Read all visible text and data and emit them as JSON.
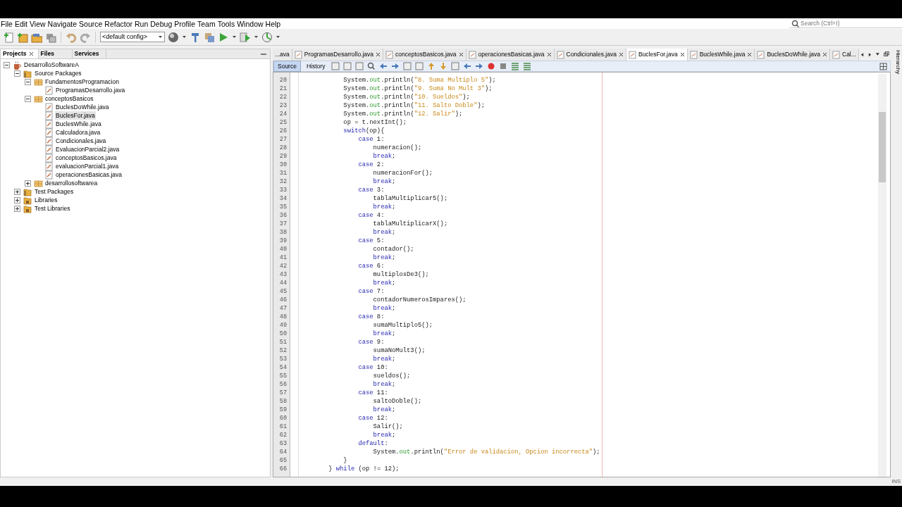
{
  "menu": [
    "File",
    "Edit",
    "View",
    "Navigate",
    "Source",
    "Refactor",
    "Run",
    "Debug",
    "Profile",
    "Team",
    "Tools",
    "Window",
    "Help"
  ],
  "search": {
    "placeholder": "Search (Ctrl+I)"
  },
  "toolbar": {
    "config": "<default config>"
  },
  "panel_tabs": [
    {
      "label": "Projects",
      "selected": true,
      "closable": true
    },
    {
      "label": "Files",
      "selected": false,
      "closable": false
    },
    {
      "label": "Services",
      "selected": false,
      "closable": false
    }
  ],
  "tree": [
    {
      "label": "DesarrolloSoftwareA",
      "kind": "project",
      "expanded": true,
      "selected": false,
      "children": [
        {
          "label": "Source Packages",
          "kind": "folder",
          "expanded": true,
          "selected": false,
          "children": [
            {
              "label": "FundamentosProgramacion",
              "kind": "package",
              "expanded": true,
              "selected": false,
              "children": [
                {
                  "label": "ProgramasDesarrollo.java",
                  "kind": "file",
                  "selected": false
                }
              ]
            },
            {
              "label": "conceptosBasicos",
              "kind": "package",
              "expanded": true,
              "selected": false,
              "children": [
                {
                  "label": "BuclesDoWhile.java",
                  "kind": "file",
                  "selected": false
                },
                {
                  "label": "BuclesFor.java",
                  "kind": "file",
                  "selected": true
                },
                {
                  "label": "BuclesWhile.java",
                  "kind": "file",
                  "selected": false
                },
                {
                  "label": "Calculadora.java",
                  "kind": "file",
                  "selected": false
                },
                {
                  "label": "Condicionales.java",
                  "kind": "file",
                  "selected": false
                },
                {
                  "label": "EvaluacionParcial2.java",
                  "kind": "file",
                  "selected": false
                },
                {
                  "label": "conceptosBasicos.java",
                  "kind": "file",
                  "selected": false
                },
                {
                  "label": "evaluacionParcial1.java",
                  "kind": "file",
                  "selected": false
                },
                {
                  "label": "operacionesBasicas.java",
                  "kind": "file",
                  "selected": false
                }
              ]
            },
            {
              "label": "desarrollosoftwarea",
              "kind": "package",
              "expanded": false,
              "selected": false
            }
          ]
        },
        {
          "label": "Test Packages",
          "kind": "folder",
          "expanded": false,
          "selected": false
        },
        {
          "label": "Libraries",
          "kind": "library",
          "expanded": false,
          "selected": false
        },
        {
          "label": "Test Libraries",
          "kind": "library",
          "expanded": false,
          "selected": false
        }
      ]
    }
  ],
  "editor_tabs": [
    {
      "label": "...ava",
      "selected": false,
      "closable": false
    },
    {
      "label": "ProgramasDesarrollo.java",
      "selected": false,
      "closable": true
    },
    {
      "label": "conceptosBasicos.java",
      "selected": false,
      "closable": true
    },
    {
      "label": "operacionesBasicas.java",
      "selected": false,
      "closable": true
    },
    {
      "label": "Condicionales.java",
      "selected": false,
      "closable": true
    },
    {
      "label": "BuclesFor.java",
      "selected": true,
      "closable": true
    },
    {
      "label": "BuclesWhile.java",
      "selected": false,
      "closable": true
    },
    {
      "label": "BuclesDoWhile.java",
      "selected": false,
      "closable": true
    },
    {
      "label": "Cal...",
      "selected": false,
      "closable": false
    }
  ],
  "view_tabs": [
    {
      "label": "Source",
      "selected": true
    },
    {
      "label": "History",
      "selected": false
    }
  ],
  "code": [
    {
      "number": "20",
      "parts": [
        {
          "plain": "            System."
        },
        {
          "field": "out"
        },
        {
          "plain": ".println("
        },
        {
          "string": "\"8. Suma Multiplo 5\""
        },
        {
          "plain": ");"
        }
      ]
    },
    {
      "number": "21",
      "parts": [
        {
          "plain": "            System."
        },
        {
          "field": "out"
        },
        {
          "plain": ".println("
        },
        {
          "string": "\"9. Suma No Mult 3\""
        },
        {
          "plain": ");"
        }
      ]
    },
    {
      "number": "22",
      "parts": [
        {
          "plain": "            System."
        },
        {
          "field": "out"
        },
        {
          "plain": ".println("
        },
        {
          "string": "\"10. Sueldos\""
        },
        {
          "plain": ");"
        }
      ]
    },
    {
      "number": "23",
      "parts": [
        {
          "plain": "            System."
        },
        {
          "field": "out"
        },
        {
          "plain": ".println("
        },
        {
          "string": "\"11. Salto Doble\""
        },
        {
          "plain": ");"
        }
      ]
    },
    {
      "number": "24",
      "parts": [
        {
          "plain": "            System."
        },
        {
          "field": "out"
        },
        {
          "plain": ".println("
        },
        {
          "string": "\"12. Salir\""
        },
        {
          "plain": ");"
        }
      ]
    },
    {
      "number": "25",
      "parts": [
        {
          "plain": "            op = t.nextInt();"
        }
      ]
    },
    {
      "number": "26",
      "parts": [
        {
          "keyword": "            switch"
        },
        {
          "plain": "(op){"
        }
      ]
    },
    {
      "number": "27",
      "parts": [
        {
          "keyword": "                case"
        },
        {
          "plain": " 1:"
        }
      ]
    },
    {
      "number": "28",
      "parts": [
        {
          "plain": "                    numeracion();"
        }
      ]
    },
    {
      "number": "29",
      "parts": [
        {
          "keyword": "                    break"
        },
        {
          "plain": ";"
        }
      ]
    },
    {
      "number": "30",
      "parts": [
        {
          "keyword": "                case"
        },
        {
          "plain": " 2:"
        }
      ]
    },
    {
      "number": "31",
      "parts": [
        {
          "plain": "                    numeracionFor();"
        }
      ]
    },
    {
      "number": "32",
      "parts": [
        {
          "keyword": "                    break"
        },
        {
          "plain": ";"
        }
      ]
    },
    {
      "number": "33",
      "parts": [
        {
          "keyword": "                case"
        },
        {
          "plain": " 3:"
        }
      ]
    },
    {
      "number": "34",
      "parts": [
        {
          "plain": "                    tablaMultiplicar5();"
        }
      ]
    },
    {
      "number": "35",
      "parts": [
        {
          "keyword": "                    break"
        },
        {
          "plain": ";"
        }
      ]
    },
    {
      "number": "36",
      "parts": [
        {
          "keyword": "                case"
        },
        {
          "plain": " 4:"
        }
      ]
    },
    {
      "number": "37",
      "parts": [
        {
          "plain": "                    tablaMultiplicarX();"
        }
      ]
    },
    {
      "number": "38",
      "parts": [
        {
          "keyword": "                    break"
        },
        {
          "plain": ";"
        }
      ]
    },
    {
      "number": "39",
      "parts": [
        {
          "keyword": "                case"
        },
        {
          "plain": " 5:"
        }
      ]
    },
    {
      "number": "40",
      "parts": [
        {
          "plain": "                    contador();"
        }
      ]
    },
    {
      "number": "41",
      "parts": [
        {
          "keyword": "                    break"
        },
        {
          "plain": ";"
        }
      ]
    },
    {
      "number": "42",
      "parts": [
        {
          "keyword": "                case"
        },
        {
          "plain": " 6:"
        }
      ]
    },
    {
      "number": "43",
      "parts": [
        {
          "plain": "                    multiplosDe3();"
        }
      ]
    },
    {
      "number": "44",
      "parts": [
        {
          "keyword": "                    break"
        },
        {
          "plain": ";"
        }
      ]
    },
    {
      "number": "45",
      "parts": [
        {
          "keyword": "                case"
        },
        {
          "plain": " 7:"
        }
      ]
    },
    {
      "number": "46",
      "parts": [
        {
          "plain": "                    contadorNumerosImpares();"
        }
      ]
    },
    {
      "number": "47",
      "parts": [
        {
          "keyword": "                    break"
        },
        {
          "plain": ";"
        }
      ]
    },
    {
      "number": "48",
      "parts": [
        {
          "keyword": "                case"
        },
        {
          "plain": " 8:"
        }
      ]
    },
    {
      "number": "49",
      "parts": [
        {
          "plain": "                    sumaMultiplo5();"
        }
      ]
    },
    {
      "number": "50",
      "parts": [
        {
          "keyword": "                    break"
        },
        {
          "plain": ";"
        }
      ]
    },
    {
      "number": "51",
      "parts": [
        {
          "keyword": "                case"
        },
        {
          "plain": " 9:"
        }
      ]
    },
    {
      "number": "52",
      "parts": [
        {
          "plain": "                    sumaNoMult3();"
        }
      ]
    },
    {
      "number": "53",
      "parts": [
        {
          "keyword": "                    break"
        },
        {
          "plain": ";"
        }
      ]
    },
    {
      "number": "54",
      "parts": [
        {
          "keyword": "                case"
        },
        {
          "plain": " 10:"
        }
      ]
    },
    {
      "number": "55",
      "parts": [
        {
          "plain": "                    sueldos();"
        }
      ]
    },
    {
      "number": "56",
      "parts": [
        {
          "keyword": "                    break"
        },
        {
          "plain": ";"
        }
      ]
    },
    {
      "number": "57",
      "parts": [
        {
          "keyword": "                case"
        },
        {
          "plain": " 11:"
        }
      ]
    },
    {
      "number": "58",
      "parts": [
        {
          "plain": "                    saltoDoble();"
        }
      ]
    },
    {
      "number": "59",
      "parts": [
        {
          "keyword": "                    break"
        },
        {
          "plain": ";"
        }
      ]
    },
    {
      "number": "60",
      "parts": [
        {
          "keyword": "                case"
        },
        {
          "plain": " 12:"
        }
      ]
    },
    {
      "number": "61",
      "parts": [
        {
          "plain": "                    Salir();"
        }
      ]
    },
    {
      "number": "62",
      "parts": [
        {
          "keyword": "                    break"
        },
        {
          "plain": ";"
        }
      ]
    },
    {
      "number": "63",
      "parts": [
        {
          "keyword": "                default"
        },
        {
          "plain": ":"
        }
      ]
    },
    {
      "number": "64",
      "parts": [
        {
          "plain": "                    System."
        },
        {
          "field": "out"
        },
        {
          "plain": ".println("
        },
        {
          "string": "\"Error de validacion, Opcion incorrecta\""
        },
        {
          "plain": ");"
        }
      ]
    },
    {
      "number": "65",
      "parts": [
        {
          "plain": "            }"
        }
      ]
    },
    {
      "number": "66",
      "parts": [
        {
          "plain": "        } "
        },
        {
          "keyword": "while"
        },
        {
          "plain": " (op != 12);"
        }
      ]
    }
  ],
  "side_tab": "Hierarchy",
  "status_bar": {
    "mode": "INS"
  }
}
